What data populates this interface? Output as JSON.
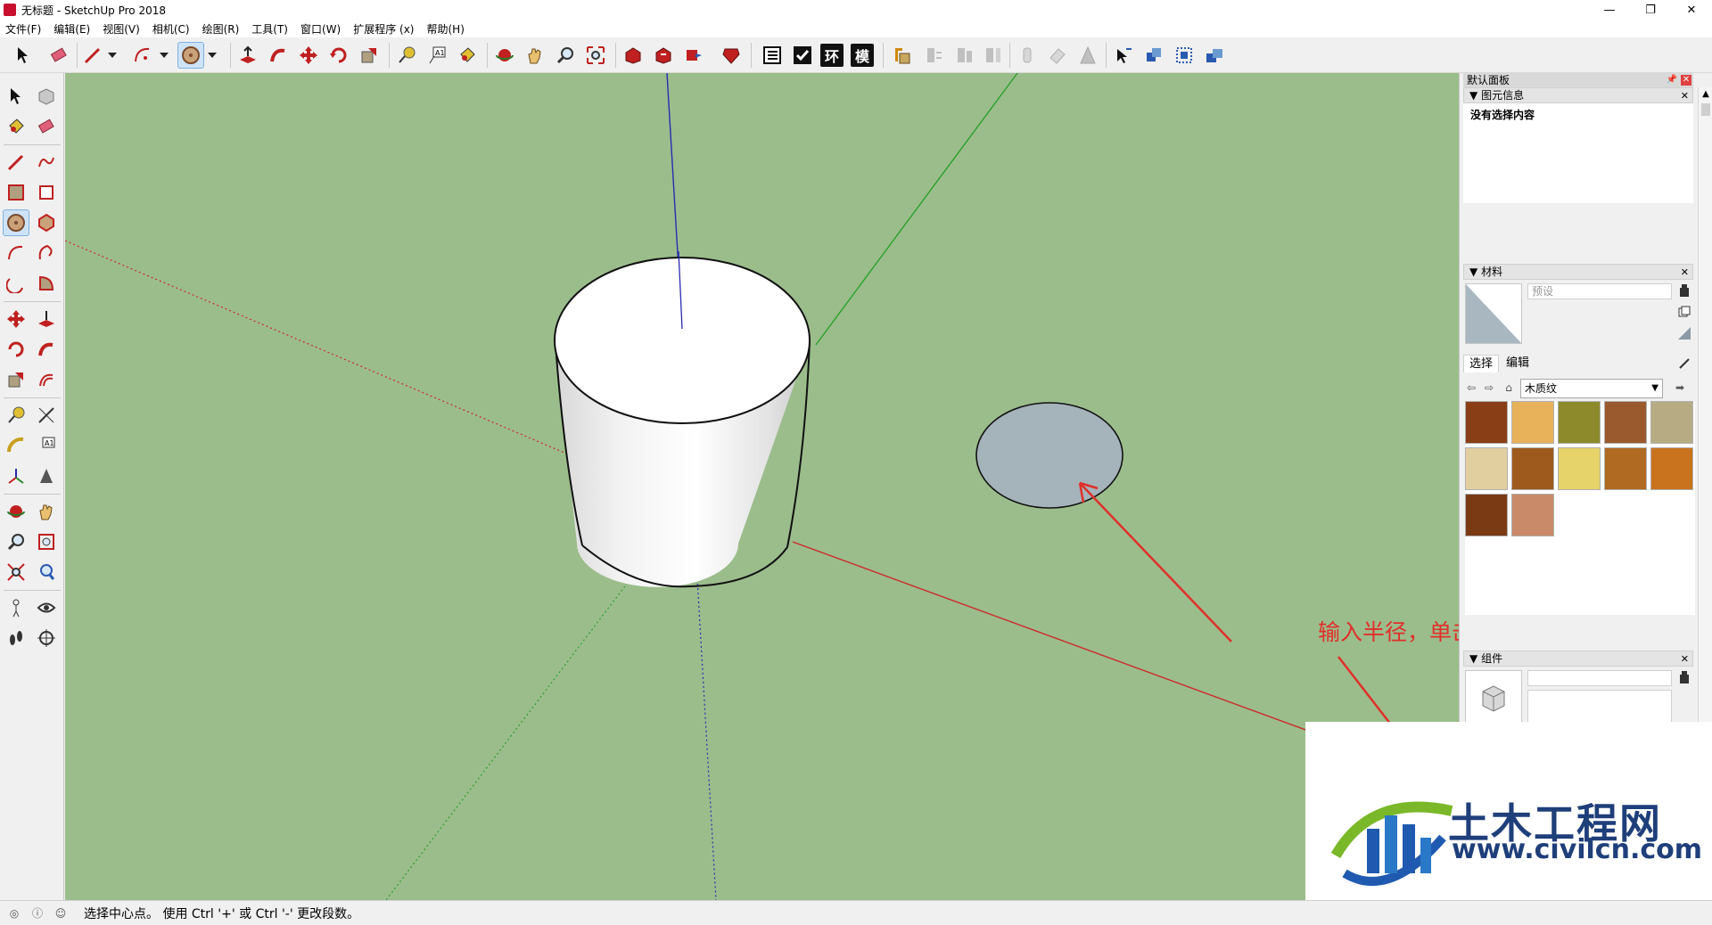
{
  "window": {
    "title": "无标题 - SketchUp Pro 2018",
    "controls": [
      "—",
      "❐",
      "✕"
    ]
  },
  "menu": [
    "文件(F)",
    "编辑(E)",
    "视图(V)",
    "相机(C)",
    "绘图(R)",
    "工具(T)",
    "窗口(W)",
    "扩展程序 (x)",
    "帮助(H)"
  ],
  "toolbar": {
    "text_buttons": [
      "环",
      "模"
    ],
    "active_tool": "circle"
  },
  "right_panel": {
    "tray_title": "默认面板",
    "entity_info": {
      "title": "图元信息",
      "content": "没有选择内容"
    },
    "materials": {
      "title": "材料",
      "name_placeholder": "预设",
      "tabs": [
        "选择",
        "编辑"
      ],
      "category": "木质纹",
      "swatch_colors": [
        "#8a3e16",
        "#e8b25a",
        "#8c8a2a",
        "#9a5a2e",
        "#b7ab84",
        "#e2cfa0",
        "#9e5a1c",
        "#e6d36a",
        "#b06a22",
        "#c9731e",
        "#7a3a14",
        "#c98a6a"
      ]
    },
    "components": {
      "title": "组件"
    }
  },
  "annotation": {
    "text": "输入半径，单击确定",
    "color": "#e0302a"
  },
  "status_bar": {
    "text": "选择中心点。 使用 Ctrl '+' 或 Ctrl '-' 更改段数。"
  },
  "watermark": {
    "brand": "土木工程网",
    "url": "www.civilcn.com"
  },
  "colors": {
    "viewport_bg": "#9bbd8c",
    "red_axis": "#cc2a2a",
    "green_axis": "#2aa02a",
    "blue_axis": "#2a2ab0",
    "circle_face": "#a5b3ba"
  }
}
